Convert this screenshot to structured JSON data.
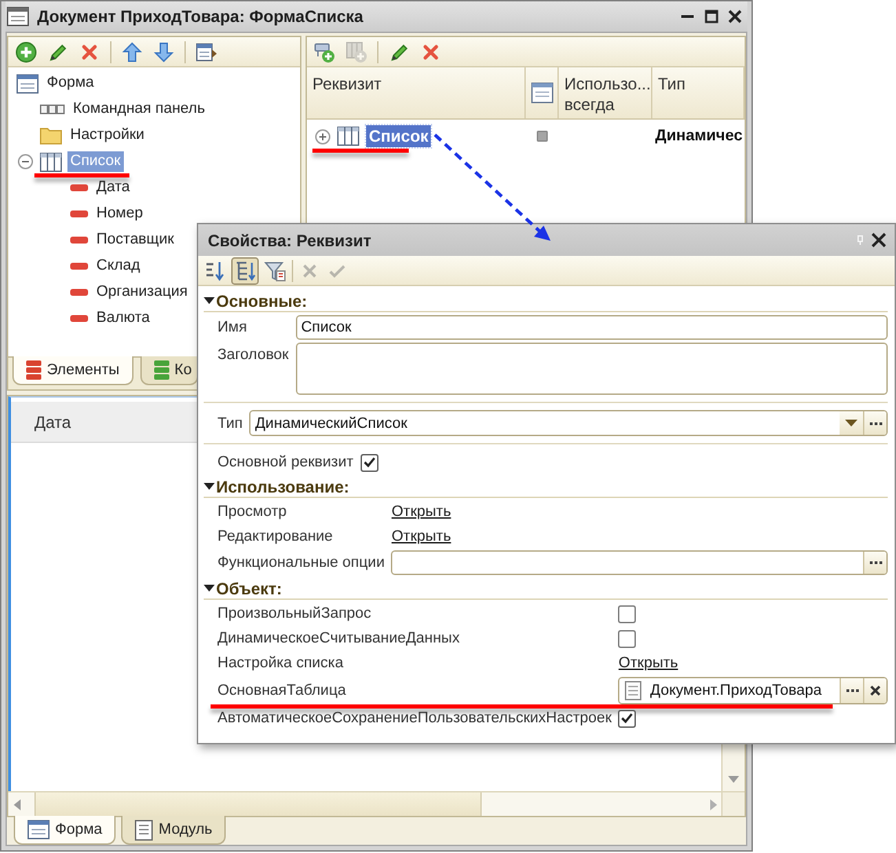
{
  "window": {
    "title": "Документ ПриходТовара: ФормаСписка"
  },
  "elements_panel": {
    "toolbar": [
      {
        "kind": "add",
        "disabled": false
      },
      {
        "kind": "edit",
        "disabled": false
      },
      {
        "kind": "delete",
        "disabled": false
      },
      {
        "kind": "separator"
      },
      {
        "kind": "move-up",
        "disabled": false
      },
      {
        "kind": "move-down",
        "disabled": false
      },
      {
        "kind": "separator"
      },
      {
        "kind": "form-settings",
        "disabled": false
      }
    ],
    "tree": [
      {
        "label": "Форма",
        "kind": "form",
        "selected": false,
        "underlined": false,
        "children": [
          {
            "label": "Командная панель",
            "kind": "command-bar",
            "selected": false,
            "underlined": false
          },
          {
            "label": "Настройки",
            "kind": "folder",
            "selected": false,
            "underlined": false
          },
          {
            "label": "Список",
            "kind": "table",
            "selected": true,
            "underlined": true,
            "expanded": true,
            "children": [
              {
                "label": "Дата",
                "kind": "field",
                "selected": false,
                "underlined": false
              },
              {
                "label": "Номер",
                "kind": "field",
                "selected": false,
                "underlined": false
              },
              {
                "label": "Поставщик",
                "kind": "field",
                "selected": false,
                "underlined": false
              },
              {
                "label": "Склад",
                "kind": "field",
                "selected": false,
                "underlined": false
              },
              {
                "label": "Организация",
                "kind": "field",
                "selected": false,
                "underlined": false
              },
              {
                "label": "Валюта",
                "kind": "field",
                "selected": false,
                "underlined": false
              }
            ]
          }
        ]
      }
    ],
    "tabs": [
      {
        "label": "Элементы",
        "kind": "elements",
        "selected": true
      },
      {
        "label": "Ко",
        "kind": "commands",
        "selected": false
      }
    ]
  },
  "attributes_panel": {
    "toolbar": [
      {
        "kind": "add-attribute",
        "disabled": false
      },
      {
        "kind": "add-column",
        "disabled": true
      },
      {
        "kind": "separator"
      },
      {
        "kind": "edit",
        "disabled": false
      },
      {
        "kind": "delete",
        "disabled": false
      }
    ],
    "columns": [
      {
        "kind": "text",
        "label": "Реквизит"
      },
      {
        "kind": "icon"
      },
      {
        "kind": "text",
        "label": "Использо... всегда"
      },
      {
        "kind": "text",
        "label": "Тип"
      }
    ],
    "rows": [
      {
        "name": "Список",
        "kind": "table",
        "expanded": false,
        "selected": true,
        "underlined": true,
        "checked": false,
        "type": "Динамичес"
      }
    ]
  },
  "form_preview": {
    "columns": [
      "Дата"
    ]
  },
  "bottom_tabs": [
    {
      "label": "Форма",
      "kind": "form",
      "selected": true
    },
    {
      "label": "Модуль",
      "kind": "module",
      "selected": false
    }
  ],
  "properties": {
    "title": "Свойства: Реквизит",
    "toolbar": [
      {
        "kind": "sort",
        "pressed": false,
        "disabled": false
      },
      {
        "kind": "categories",
        "pressed": true,
        "disabled": false
      },
      {
        "kind": "filter",
        "pressed": false,
        "disabled": false
      },
      {
        "kind": "separator"
      },
      {
        "kind": "cancel",
        "pressed": false,
        "disabled": true
      },
      {
        "kind": "apply",
        "pressed": false,
        "disabled": true
      }
    ],
    "sections": [
      {
        "title": "Основные:",
        "expanded": true,
        "rows": [
          {
            "kind": "text",
            "label": "Имя",
            "value": "Список",
            "underlined": false
          },
          {
            "kind": "textarea",
            "label": "Заголовок",
            "underlined": false
          },
          {
            "kind": "combo",
            "label": "Тип",
            "value": "ДинамическийСписок",
            "underlined": false
          },
          {
            "kind": "inline-checkbox",
            "label": "Основной реквизит",
            "checked": true,
            "underlined": false
          }
        ]
      },
      {
        "title": "Использование:",
        "expanded": true,
        "rows": [
          {
            "kind": "link",
            "label": "Просмотр",
            "value": "Открыть",
            "underlined": false
          },
          {
            "kind": "link",
            "label": "Редактирование",
            "value": "Открыть",
            "underlined": false
          },
          {
            "kind": "picker",
            "label": "Функциональные опции",
            "underlined": false
          }
        ]
      },
      {
        "title": "Объект:",
        "expanded": true,
        "rows": [
          {
            "kind": "checkbox",
            "label": "ПроизвольныйЗапрос",
            "checked": false,
            "underlined": false
          },
          {
            "kind": "checkbox",
            "label": "ДинамическоеСчитываниеДанных",
            "checked": false,
            "underlined": false
          },
          {
            "kind": "link",
            "label": "Настройка списка",
            "value": "Открыть",
            "underlined": false
          },
          {
            "kind": "ref",
            "label": "ОсновнаяТаблица",
            "value": "Документ.ПриходТовара",
            "underlined": true
          },
          {
            "kind": "checkbox",
            "label": "АвтоматическоеСохранениеПользовательскихНастроек",
            "checked": true,
            "underlined": false
          }
        ]
      }
    ]
  }
}
